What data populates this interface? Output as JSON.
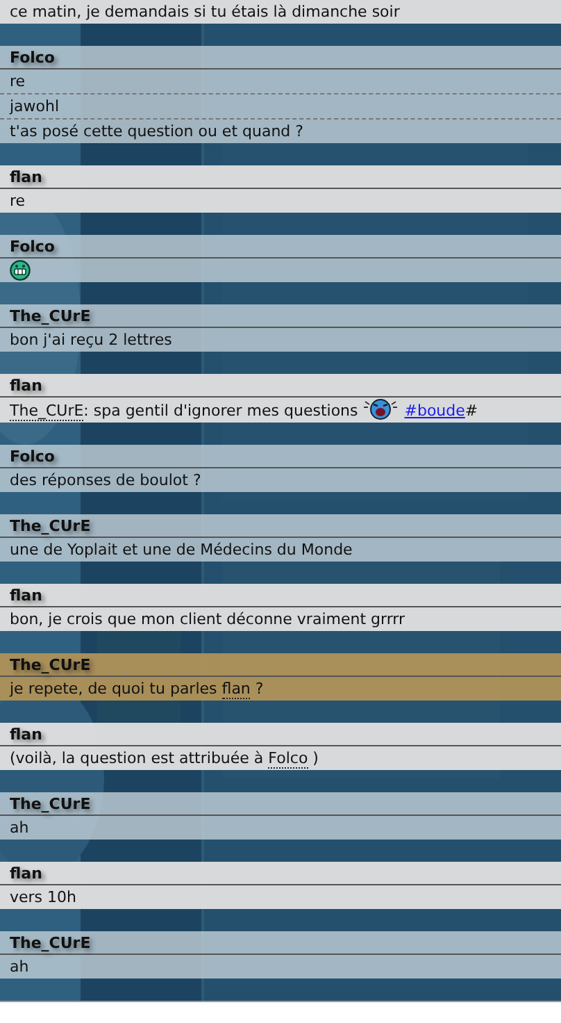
{
  "groups": [
    {
      "kind": "own",
      "highlighted": false,
      "messages": [
        [
          {
            "kind": "text",
            "text": "ce matin, je demandais si tu étais là dimanche soir"
          }
        ]
      ]
    },
    {
      "kind": "other",
      "highlighted": false,
      "author": "Folco",
      "messages": [
        [
          {
            "kind": "text",
            "text": "re"
          }
        ],
        [
          {
            "kind": "text",
            "text": "jawohl"
          }
        ],
        [
          {
            "kind": "text",
            "text": "t'as posé cette question ou et quand ?"
          }
        ]
      ]
    },
    {
      "kind": "own",
      "highlighted": false,
      "author": "flan",
      "messages": [
        [
          {
            "kind": "text",
            "text": "re"
          }
        ]
      ]
    },
    {
      "kind": "other",
      "highlighted": false,
      "author": "Folco",
      "messages": [
        [
          {
            "kind": "grin"
          }
        ]
      ]
    },
    {
      "kind": "other",
      "highlighted": false,
      "author": "The_CUrE",
      "messages": [
        [
          {
            "kind": "text",
            "text": "bon j'ai reçu 2 lettres"
          }
        ]
      ]
    },
    {
      "kind": "own",
      "highlighted": false,
      "author": "flan",
      "messages": [
        [
          {
            "kind": "nick",
            "text": "The_CUrE"
          },
          {
            "kind": "text",
            "text": ": spa gentil d'ignorer mes questions "
          },
          {
            "kind": "cry"
          },
          {
            "kind": "link",
            "text": "#boude"
          },
          {
            "kind": "text",
            "text": "#"
          }
        ]
      ]
    },
    {
      "kind": "other",
      "highlighted": false,
      "author": "Folco",
      "messages": [
        [
          {
            "kind": "text",
            "text": "des réponses de boulot ?"
          }
        ]
      ]
    },
    {
      "kind": "other",
      "highlighted": false,
      "author": "The_CUrE",
      "messages": [
        [
          {
            "kind": "text",
            "text": "une de Yoplait et une de Médecins du Monde"
          }
        ]
      ]
    },
    {
      "kind": "own",
      "highlighted": false,
      "author": "flan",
      "messages": [
        [
          {
            "kind": "text",
            "text": "bon, je crois que mon client déconne vraiment grrrr"
          }
        ]
      ]
    },
    {
      "kind": "other",
      "highlighted": true,
      "author": "The_CUrE",
      "messages": [
        [
          {
            "kind": "text",
            "text": "je repete, de quoi tu parles "
          },
          {
            "kind": "nick",
            "text": "flan"
          },
          {
            "kind": "text",
            "text": " ?"
          }
        ]
      ]
    },
    {
      "kind": "own",
      "highlighted": false,
      "author": "flan",
      "messages": [
        [
          {
            "kind": "text",
            "text": "(voilà, la question est attribuée à "
          },
          {
            "kind": "nick",
            "text": "Folco"
          },
          {
            "kind": "text",
            "text": " )"
          }
        ]
      ]
    },
    {
      "kind": "other",
      "highlighted": false,
      "author": "The_CUrE",
      "messages": [
        [
          {
            "kind": "text",
            "text": "ah"
          }
        ]
      ]
    },
    {
      "kind": "own",
      "highlighted": false,
      "author": "flan",
      "messages": [
        [
          {
            "kind": "text",
            "text": "vers 10h"
          }
        ]
      ]
    },
    {
      "kind": "other",
      "highlighted": false,
      "author": "The_CUrE",
      "messages": [
        [
          {
            "kind": "text",
            "text": "ah"
          }
        ]
      ]
    }
  ]
}
